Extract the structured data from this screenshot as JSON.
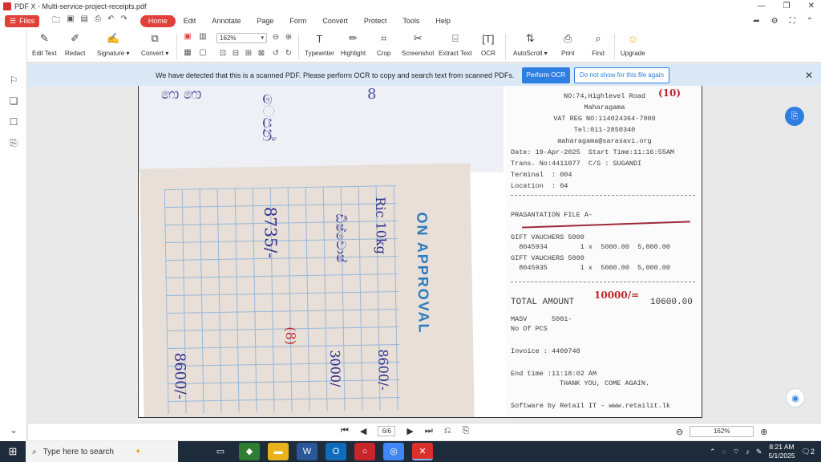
{
  "window": {
    "title": "PDF X - Multi-service-project-receipts.pdf",
    "controls": [
      "share-icon",
      "settings-icon",
      "fullscreen-icon",
      "collapse-icon"
    ]
  },
  "menubar": {
    "files_label": "Files",
    "menus": [
      "Home",
      "Edit",
      "Annotate",
      "Page",
      "Form",
      "Convert",
      "Protect",
      "Tools",
      "Help"
    ],
    "active_menu": "Home"
  },
  "toolbar": {
    "edit_text": "Edit Text",
    "redact": "Redact",
    "signature": "Signature ▾",
    "convert": "Convert ▾",
    "zoom_value": "162%",
    "typewriter": "Typewriter",
    "highlight": "Highlight",
    "crop": "Crop",
    "screenshot": "Screenshot",
    "extract_text": "Extract Text",
    "ocr": "OCR",
    "autoscroll": "AutoScroll ▾",
    "print": "Print",
    "find": "Find",
    "upgrade": "Upgrade"
  },
  "banner": {
    "message": "We have detected that this is a scanned PDF.  Please perform OCR to copy and search text from scanned PDFs.",
    "perform_ocr": "Perform OCR",
    "dont_show": "Do not show for this file again"
  },
  "document": {
    "bill_header": "ON APPROVAL",
    "receipt": {
      "lines": [
        "NO:74,Highlevel Road",
        "Maharagama",
        "VAT REG NO:114024364-7000",
        "Tel:011-2850340",
        "maharagama@sarasavi.org",
        "Date: 19-Apr-2025  Start Time:11:16:55AM",
        "Trans. No:4411077  C/S : SUGANDI",
        "Terminal  : 004",
        "Location  : 04",
        "PRASANTATION FILE A-",
        "GIFT VAUCHERS 5000",
        "  8045934        1 x  5000.00  5,000.00",
        "GIFT VAUCHERS 5000",
        "  8045935        1 x  5000.00  5,000.00",
        "TOTAL AMOUNT",
        "10600.00",
        "MASV      5001-",
        "No Of PCS",
        "Invoice : 4409748",
        "End time :11:18:02 AM",
        "THANK YOU, COME AGAIN.",
        "Software by Retail IT - www.retailit.lk"
      ],
      "handwritten_total": "10000/=",
      "handwritten_mark": "(10)"
    }
  },
  "statusbar": {
    "page_display": "6/6",
    "zoom_display": "162%"
  },
  "taskbar": {
    "search_placeholder": "Type here to search",
    "time": "8:21 AM",
    "date": "5/1/2025",
    "notification_count": "2"
  },
  "colors": {
    "accent": "#e0403a",
    "banner_bg": "#dbe9f7",
    "ocr_button": "#2f7fe3",
    "taskbar": "#1d2b3a"
  }
}
